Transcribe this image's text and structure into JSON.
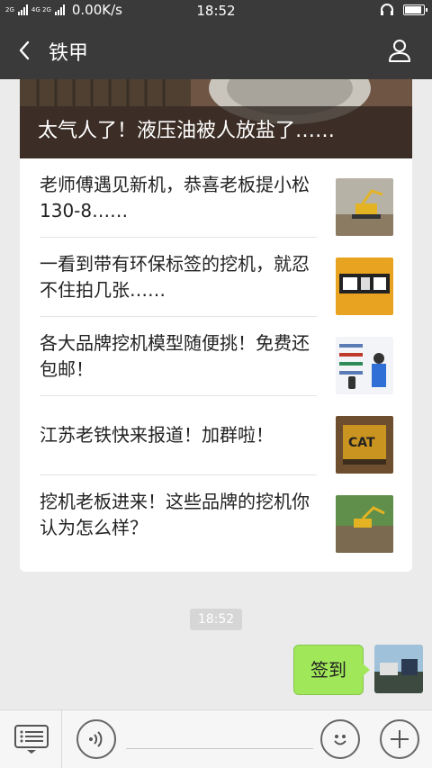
{
  "status_bar": {
    "network_left": "2G",
    "network_right": "4G 2G",
    "speed": "0.00K/s",
    "time": "18:52"
  },
  "nav": {
    "title": "铁甲",
    "back_icon": "chevron-left-icon",
    "profile_icon": "person-icon"
  },
  "article_card": {
    "hero": {
      "caption": "太气人了！液压油被人放盐了……"
    },
    "items": [
      {
        "title": "老师傅遇见新机，恭喜老板提小松130-8……"
      },
      {
        "title": "一看到带有环保标签的挖机，就忍不住拍几张……"
      },
      {
        "title": "各大品牌挖机模型随便挑！免费还包邮！"
      },
      {
        "title": "江苏老铁快来报道！加群啦！"
      },
      {
        "title": "挖机老板进来！这些品牌的挖机你认为怎么样？"
      }
    ]
  },
  "chat": {
    "timestamp": "18:52",
    "message": "签到"
  },
  "input_bar": {
    "menu_icon": "menu-list-icon",
    "voice_icon": "voice-icon",
    "emoji_icon": "emoji-icon",
    "plus_icon": "plus-icon"
  },
  "colors": {
    "bar_dark": "#3a3a3a",
    "bubble_green": "#a0e759",
    "background": "#ebebeb"
  }
}
